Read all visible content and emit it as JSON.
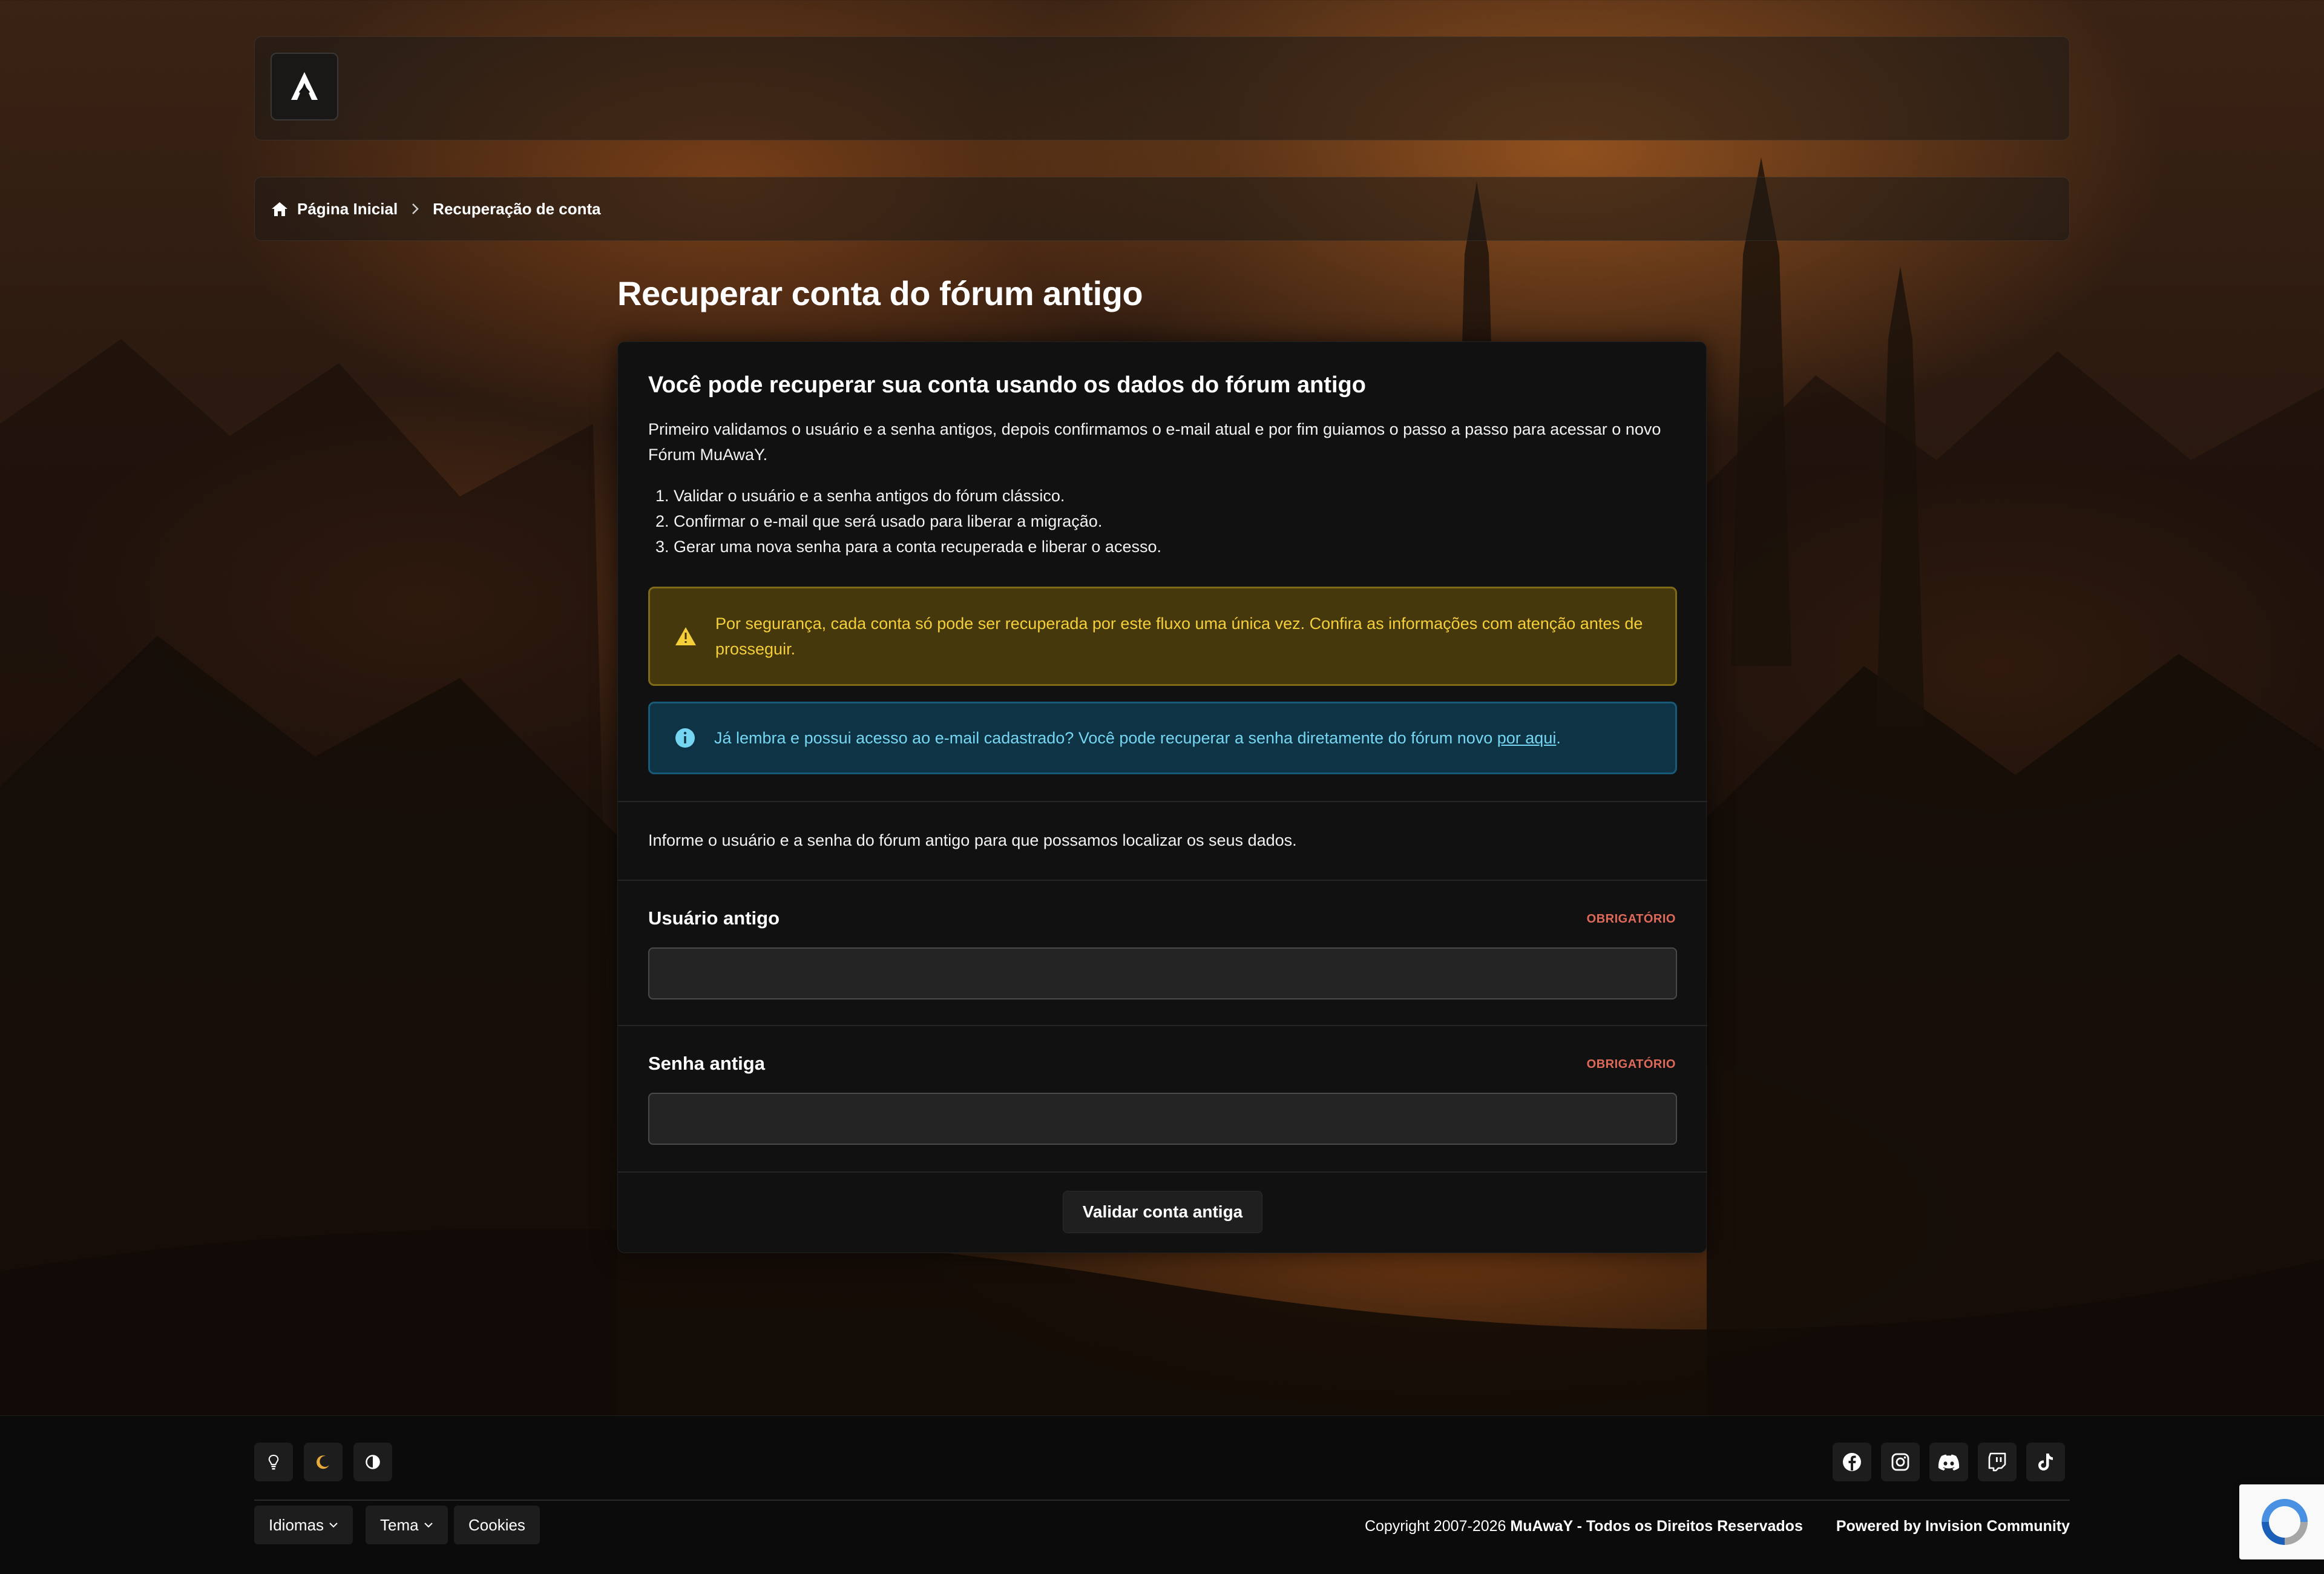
{
  "breadcrumb": {
    "home_label": "Página Inicial",
    "current_label": "Recuperação de conta"
  },
  "page": {
    "title": "Recuperar conta do fórum antigo"
  },
  "card": {
    "heading": "Você pode recuperar sua conta usando os dados do fórum antigo",
    "intro": "Primeiro validamos o usuário e a senha antigos, depois confirmamos o e-mail atual e por fim guiamos o passo a passo para acessar o novo Fórum MuAwaY.",
    "steps": [
      "Validar o usuário e a senha antigos do fórum clássico.",
      "Confirmar o e-mail que será usado para liberar a migração.",
      "Gerar uma nova senha para a conta recuperada e liberar o acesso."
    ],
    "warning": "Por segurança, cada conta só pode ser recuperada por este fluxo uma única vez. Confira as informações com atenção antes de prosseguir.",
    "info_text": "Já lembra e possui acesso ao e-mail cadastrado? Você pode recuperar a senha diretamente do fórum novo ",
    "info_link": "por aqui",
    "info_end": ".",
    "form_note": "Informe o usuário e a senha do fórum antigo para que possamos localizar os seus dados.",
    "fields": [
      {
        "label": "Usuário antigo",
        "required": "OBRIGATÓRIO",
        "value": ""
      },
      {
        "label": "Senha antiga",
        "required": "OBRIGATÓRIO",
        "value": ""
      }
    ],
    "submit_label": "Validar conta antiga"
  },
  "footer": {
    "languages_label": "Idiomas",
    "theme_label": "Tema",
    "cookies_label": "Cookies",
    "copyright_prefix": "Copyright 2007-2026 ",
    "copyright_brand": "MuAwaY",
    "copyright_suffix": " - Todos os Direitos Reservados",
    "powered_by": "Powered by Invision Community",
    "theme_icons": [
      "lightbulb-icon",
      "moon-icon",
      "contrast-icon"
    ],
    "social_icons": [
      "facebook-icon",
      "instagram-icon",
      "discord-icon",
      "twitch-icon",
      "tiktok-icon"
    ]
  },
  "colors": {
    "warning_text": "#f4cf3a",
    "info_text": "#76d6f2",
    "required": "#e06a5a",
    "moon_accent": "#e8a93a"
  }
}
